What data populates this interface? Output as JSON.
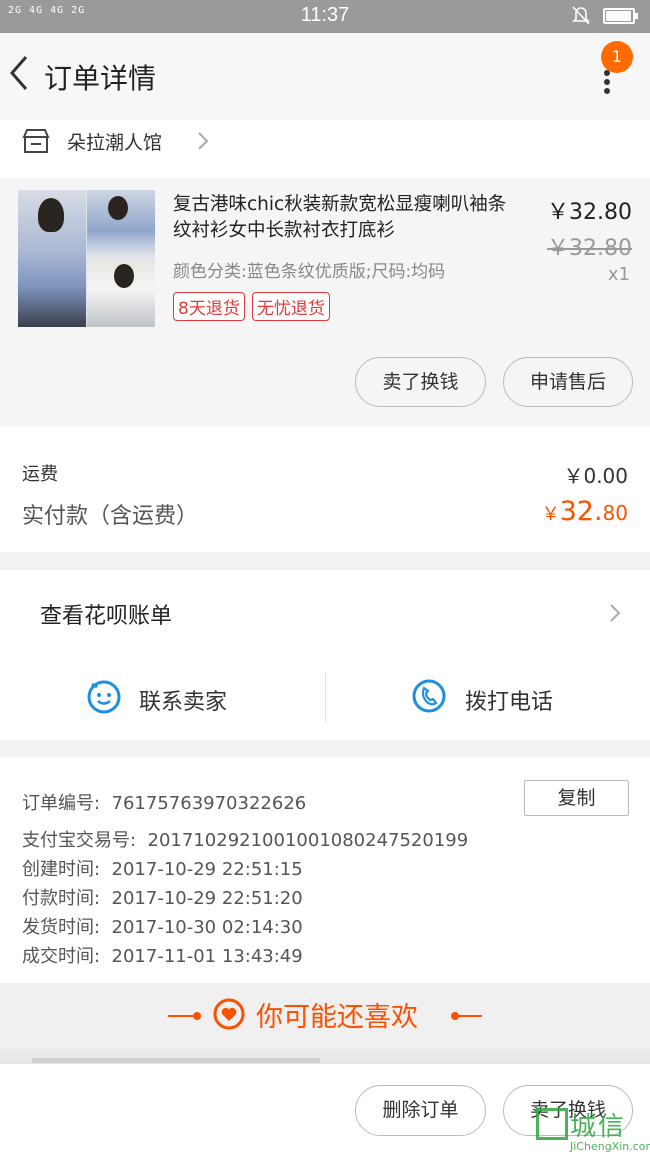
{
  "status_bar": {
    "signal": "2G 4G 4G 2G",
    "time": "11:37",
    "battery_level": 0.95
  },
  "header": {
    "title": "订单详情",
    "badge_count": "1"
  },
  "shop": {
    "name": "朵拉潮人馆"
  },
  "product": {
    "name": "复古港味chic秋装新款宽松显瘦喇叭袖条纹衬衫女中长款衬衣打底衫",
    "spec": "颜色分类:蓝色条纹优质版;尺码:均码",
    "tags": [
      "8天退货",
      "无忧退货"
    ],
    "price": "￥32.80",
    "original_price": "￥32.80",
    "quantity": "x1",
    "buttons": {
      "sell": "卖了换钱",
      "after_sale": "申请售后"
    }
  },
  "costs": {
    "shipping_label": "运费",
    "shipping_value": "￥0.00",
    "paid_label": "实付款（含运费）",
    "paid_currency": "￥",
    "paid_int": "32.",
    "paid_dec": "80"
  },
  "huabei": {
    "label": "查看花呗账单"
  },
  "contact": {
    "seller": "联系卖家",
    "phone": "拨打电话"
  },
  "order_info": {
    "copy_label": "复制",
    "rows": [
      {
        "label": "订单编号:",
        "value": "76175763970322626"
      },
      {
        "label": "支付宝交易号:",
        "value": "2017102921001001080247520199"
      },
      {
        "label": "创建时间:",
        "value": "2017-10-29 22:51:15"
      },
      {
        "label": "付款时间:",
        "value": "2017-10-29 22:51:20"
      },
      {
        "label": "发货时间:",
        "value": "2017-10-30 02:14:30"
      },
      {
        "label": "成交时间:",
        "value": "2017-11-01 13:43:49"
      }
    ]
  },
  "recommend": {
    "title": "你可能还喜欢"
  },
  "bottom": {
    "delete": "删除订单",
    "sell": "卖了换钱"
  },
  "watermark": {
    "cn": "城信",
    "en": "JiChengXin.com"
  },
  "colors": {
    "accent": "#ff5000",
    "badge": "#ff6a00",
    "tag": "#e4393c",
    "icon_blue": "#1e8fe1"
  }
}
